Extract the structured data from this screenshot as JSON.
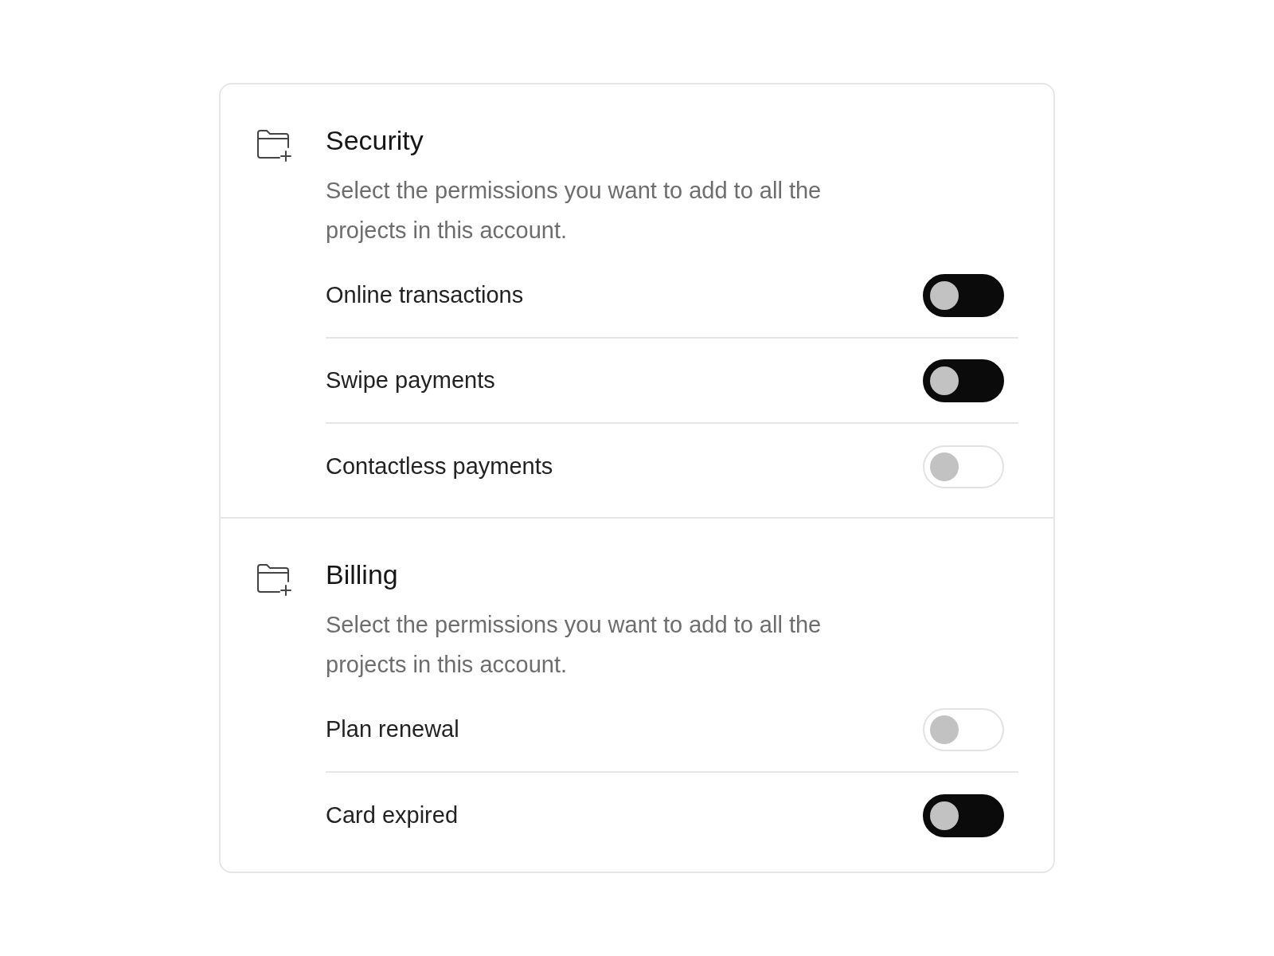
{
  "sections": [
    {
      "title": "Security",
      "description": "Select the permissions you want to add to all the projects in this account.",
      "options": [
        {
          "label": "Online transactions",
          "on": true
        },
        {
          "label": "Swipe payments",
          "on": true
        },
        {
          "label": "Contactless payments",
          "on": false
        }
      ]
    },
    {
      "title": "Billing",
      "description": "Select the permissions you want to add to all the projects in this account.",
      "options": [
        {
          "label": "Plan renewal",
          "on": false
        },
        {
          "label": "Card expired",
          "on": true
        }
      ]
    }
  ]
}
